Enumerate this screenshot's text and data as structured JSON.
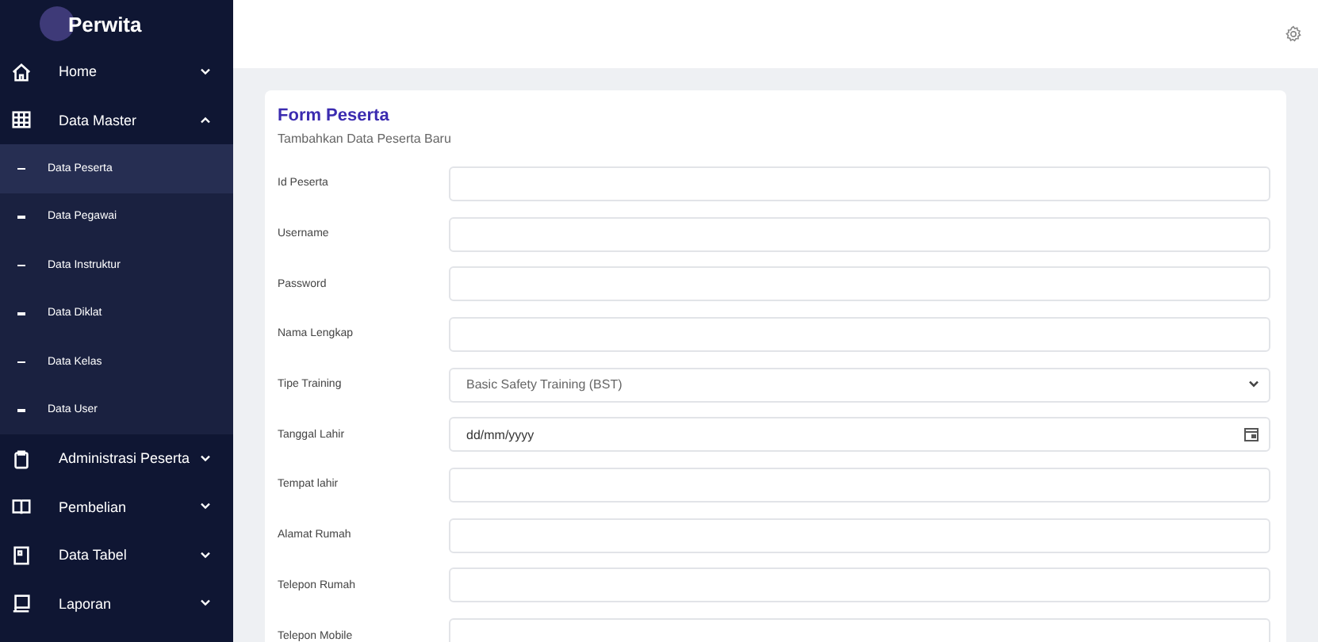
{
  "sidebar": {
    "brand": "Perwita",
    "items": [
      {
        "label": "Home",
        "expanded": false
      },
      {
        "label": "Data Master",
        "expanded": true,
        "children": [
          {
            "label": "Data Peserta",
            "selected": true
          },
          {
            "label": "Data Pegawai",
            "selected": false
          },
          {
            "label": "Data Instruktur",
            "selected": false
          },
          {
            "label": "Data Diklat",
            "selected": false
          },
          {
            "label": "Data Kelas",
            "selected": false
          },
          {
            "label": "Data User",
            "selected": false
          }
        ]
      },
      {
        "label": "Administrasi Peserta",
        "expanded": false
      },
      {
        "label": "Pembelian",
        "expanded": false
      },
      {
        "label": "Data Tabel",
        "expanded": false
      },
      {
        "label": "Laporan",
        "expanded": false
      }
    ]
  },
  "form": {
    "title": "Form Peserta",
    "subtitle": "Tambahkan Data Peserta Baru",
    "fields": [
      {
        "label": "Id Peserta",
        "kind": "text"
      },
      {
        "label": "Username",
        "kind": "text"
      },
      {
        "label": "Password",
        "kind": "text"
      },
      {
        "label": "Nama Lengkap",
        "kind": "text"
      },
      {
        "label": "Tipe Training",
        "kind": "select",
        "value": "Basic Safety Training (BST)"
      },
      {
        "label": "Tanggal Lahir",
        "kind": "date",
        "placeholder": "dd/mm/yyyy"
      },
      {
        "label": "Tempat lahir",
        "kind": "text"
      },
      {
        "label": "Alamat Rumah",
        "kind": "text"
      },
      {
        "label": "Telepon Rumah",
        "kind": "text"
      },
      {
        "label": "Telepon Mobile",
        "kind": "text"
      }
    ]
  }
}
